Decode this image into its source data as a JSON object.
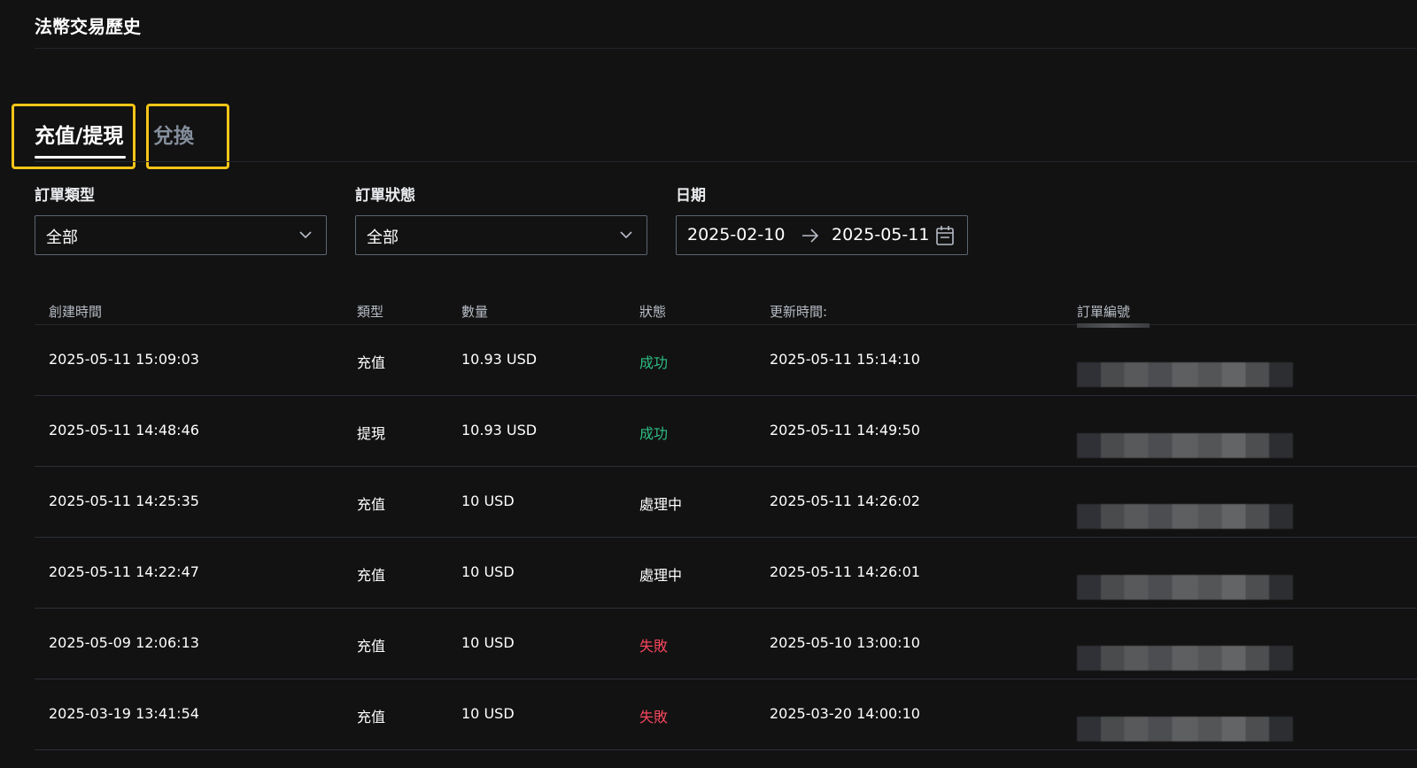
{
  "page": {
    "title": "法幣交易歷史"
  },
  "tabs": [
    {
      "label": "充值/提現",
      "active": true
    },
    {
      "label": "兌換",
      "active": false
    }
  ],
  "filters": {
    "order_type": {
      "label": "訂單類型",
      "value": "全部"
    },
    "order_status": {
      "label": "訂單狀態",
      "value": "全部"
    },
    "date": {
      "label": "日期",
      "start": "2025-02-10",
      "end": "2025-05-11"
    }
  },
  "table": {
    "headers": [
      "創建時間",
      "類型",
      "數量",
      "狀態",
      "更新時間:",
      "訂單編號"
    ],
    "rows": [
      {
        "created": "2025-05-11 15:09:03",
        "type": "充值",
        "amount": "10.93 USD",
        "status": "成功",
        "status_kind": "success",
        "updated": "2025-05-11 15:14:10"
      },
      {
        "created": "2025-05-11 14:48:46",
        "type": "提現",
        "amount": "10.93 USD",
        "status": "成功",
        "status_kind": "success",
        "updated": "2025-05-11 14:49:50"
      },
      {
        "created": "2025-05-11 14:25:35",
        "type": "充值",
        "amount": "10 USD",
        "status": "處理中",
        "status_kind": "processing",
        "updated": "2025-05-11 14:26:02"
      },
      {
        "created": "2025-05-11 14:22:47",
        "type": "充值",
        "amount": "10 USD",
        "status": "處理中",
        "status_kind": "processing",
        "updated": "2025-05-11 14:26:01"
      },
      {
        "created": "2025-05-09 12:06:13",
        "type": "充值",
        "amount": "10 USD",
        "status": "失敗",
        "status_kind": "fail",
        "updated": "2025-05-10 13:00:10"
      },
      {
        "created": "2025-03-19 13:41:54",
        "type": "充值",
        "amount": "10 USD",
        "status": "失敗",
        "status_kind": "fail",
        "updated": "2025-03-20 14:00:10"
      }
    ]
  },
  "colors": {
    "background": "#121212",
    "highlight_box": "#f5c518",
    "success": "#2ebd85",
    "fail": "#f6465d"
  },
  "icons": {
    "dropdown": "chevron-down-icon",
    "date_separator": "arrow-right-icon",
    "date_picker": "calendar-icon"
  }
}
